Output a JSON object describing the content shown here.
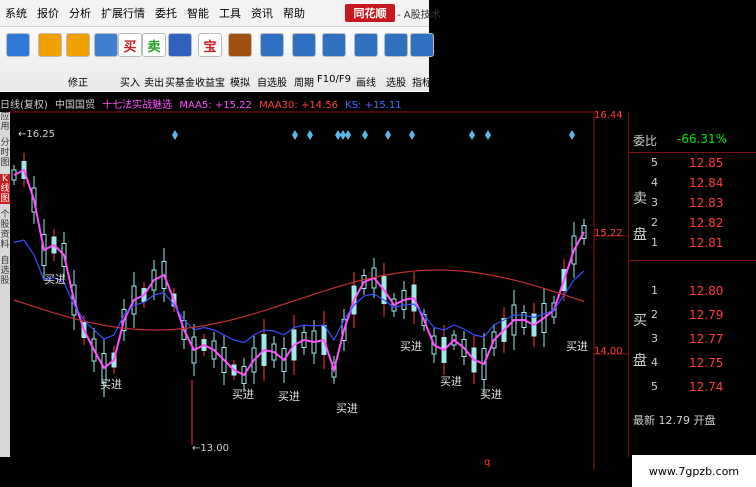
{
  "menubar": {
    "items": [
      "系统",
      "报价",
      "分析",
      "扩展行情",
      "委托",
      "智能",
      "工具",
      "资讯",
      "帮助"
    ],
    "logo": "同花顺",
    "title": "- A股技术"
  },
  "toolbar": {
    "buttons": [
      {
        "label": "",
        "icon": "app-icon"
      },
      {
        "label": "",
        "icon": "back-arrow-icon"
      },
      {
        "label": "修正",
        "icon": "up-down-arrow-icon"
      },
      {
        "label": "",
        "icon": "clock-icon"
      },
      {
        "label": "买入",
        "icon": "buy-icon",
        "glyph": "买"
      },
      {
        "label": "卖出",
        "icon": "sell-icon",
        "glyph": "卖"
      },
      {
        "label": "买基金",
        "icon": "fund-icon"
      },
      {
        "label": "收益宝",
        "icon": "treasure-icon",
        "glyph": "宝"
      },
      {
        "label": "模拟",
        "icon": "hammer-icon"
      },
      {
        "label": "自选股",
        "icon": "watchlist-icon"
      },
      {
        "label": "周期",
        "icon": "period-icon"
      },
      {
        "label": "F10/F9",
        "icon": "f10-icon"
      },
      {
        "label": "画线",
        "icon": "pen-icon"
      },
      {
        "label": "选股",
        "icon": "stock-pick-icon"
      },
      {
        "label": "指标",
        "icon": "indicator-icon"
      }
    ]
  },
  "chart_header": {
    "period": "日线(复权)",
    "stock": "中国国贸",
    "formula": "十七法实战魅选",
    "ma5": "MAA5: +15.22",
    "ma30": "MAA30: +14.56",
    "ks": "KS: +15.11"
  },
  "leftbar": {
    "labels": [
      "应用",
      "分时图",
      "K线图",
      "个股资料",
      "自选股"
    ]
  },
  "chart_data": {
    "type": "candlestick",
    "price_labels": [
      "16.44",
      "15.22",
      "14.00"
    ],
    "annotations": {
      "high": "16.25",
      "low": "13.00"
    },
    "signal_label": "买进",
    "bottom_marker": "q"
  },
  "order_book": {
    "header_label": "委比",
    "header_value": "-66.31%",
    "sell_side_label": [
      "卖",
      "盘"
    ],
    "sells": [
      {
        "level": "5",
        "price": "12.85"
      },
      {
        "level": "4",
        "price": "12.84"
      },
      {
        "level": "3",
        "price": "12.83"
      },
      {
        "level": "2",
        "price": "12.82"
      },
      {
        "level": "1",
        "price": "12.81"
      }
    ],
    "buy_side_label": [
      "买",
      "盘"
    ],
    "buys": [
      {
        "level": "1",
        "price": "12.80"
      },
      {
        "level": "2",
        "price": "12.79"
      },
      {
        "level": "3",
        "price": "12.77"
      },
      {
        "level": "4",
        "price": "12.75"
      },
      {
        "level": "5",
        "price": "12.74"
      }
    ],
    "footer": "最新 12.79 开盘"
  },
  "watermark": "www.7gpzb.com"
}
